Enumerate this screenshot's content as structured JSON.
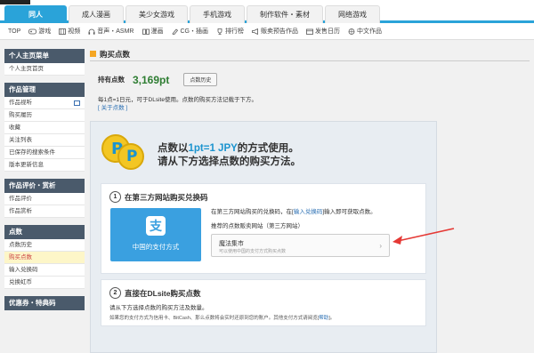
{
  "top_tabs": [
    "同人",
    "成人漫画",
    "美少女游戏",
    "手机游戏",
    "制作软件・素材",
    "网络游戏"
  ],
  "sub_nav": [
    "TOP",
    "游戏",
    "视频",
    "音声・ASMR",
    "漫画",
    "CG・插画",
    "排行榜",
    "贩卖预告作品",
    "发售日历",
    "中文作品"
  ],
  "sidebar": {
    "sections": [
      {
        "title": "个人主页菜单",
        "items": [
          "个人主页首页"
        ]
      },
      {
        "title": "作品管理",
        "items": [
          "作品视听",
          "购买履历",
          "收藏",
          "关注列表",
          "已保存的搜索条件",
          "版本更新信息"
        ]
      },
      {
        "title": "作品评价・赏析",
        "items": [
          "作品评价",
          "作品赏析"
        ]
      },
      {
        "title": "点数",
        "items": [
          "点数历史",
          "购买点数",
          "输入兑换码",
          "兑换虹币"
        ]
      },
      {
        "title": "优惠券・特典码",
        "items": []
      }
    ],
    "selected": "购买点数"
  },
  "main": {
    "title": "购买点数",
    "points_label": "持有点数",
    "points_value": "3,169pt",
    "history_button": "点数历史",
    "note_line1": "每1点=1日元，可于DLsite使用。点数的购买方法记载于下方。",
    "note_link": "[ 关于点数 ]",
    "hero_pre": "点数以",
    "hero_rate": "1pt=1 JPY",
    "hero_post": "的方式使用。",
    "hero_line2": "请从下方选择点数的购买方法。",
    "coin_glyph": "P",
    "step1": {
      "num": "1",
      "title": "在第三方网站购买兑换码",
      "alipay_glyph": "支",
      "alipay_label": "中国的支付方式",
      "desc_pre": "在第三方网站购买的兑换码，在[",
      "desc_link": "输入兑换码",
      "desc_post": "]输入即可获取点数。",
      "sub": "推荐的点数贩卖网站（第三方网站）",
      "shop_name": "魔法集市",
      "shop_sub": "可以使用中国的支付方式购买点数",
      "chevron": "›"
    },
    "step2": {
      "num": "2",
      "title": "直接在DLsite购买点数",
      "desc": "请从下方选择点数的购买方法及数量。",
      "small_pre": "如果您的支付方式为信用卡、BitCash、那么点数将会实时还原到您的账户。其他支付方式请阅览[",
      "small_link": "帮助",
      "small_post": "]。"
    }
  },
  "annotation": {
    "color": "#e53935"
  }
}
